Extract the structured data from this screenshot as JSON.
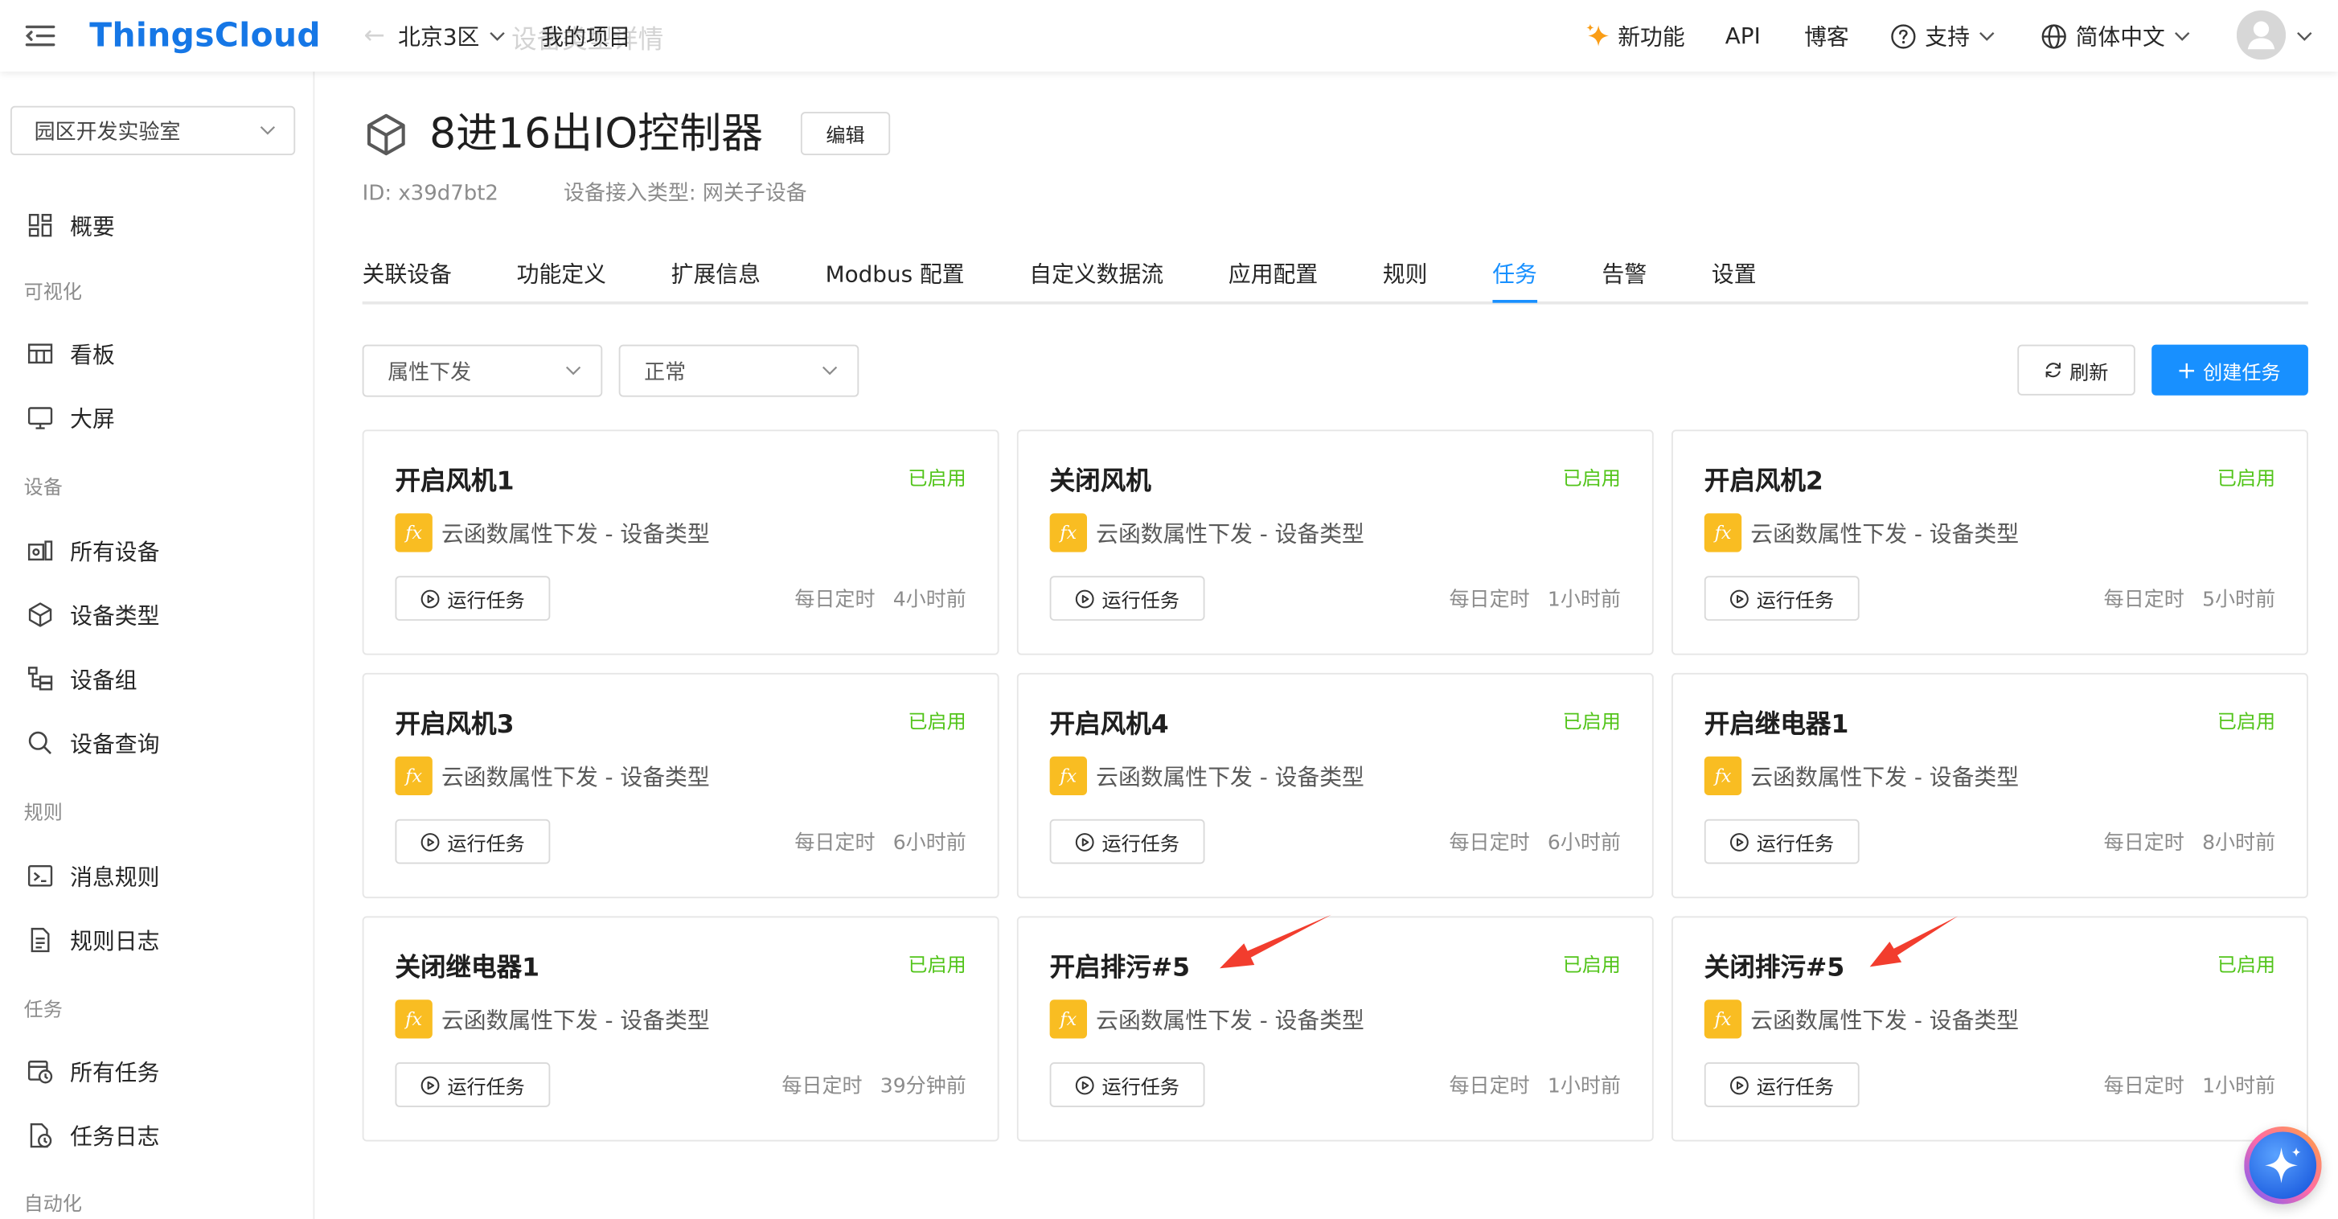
{
  "header": {
    "logo": "ThingsCloud",
    "ghost_back": "←",
    "ghost_title": "设备类型详情",
    "region": "北京3区",
    "project": "我的项目",
    "new_features": "新功能",
    "api": "API",
    "blog": "博客",
    "support": "支持",
    "language": "简体中文",
    "icons": {
      "menu": "menu-fold-icon",
      "new_features": "sparkle-icon",
      "support": "help-circle-icon",
      "language": "globe-icon",
      "avatar": "user-avatar-icon"
    }
  },
  "sidebar": {
    "workspace": "园区开发实验室",
    "overview": {
      "label": "概要",
      "icon": "grid-icon"
    },
    "sections": [
      {
        "label": "可视化",
        "items": [
          {
            "label": "看板",
            "icon": "dashboard-icon"
          },
          {
            "label": "大屏",
            "icon": "monitor-icon"
          }
        ]
      },
      {
        "label": "设备",
        "items": [
          {
            "label": "所有设备",
            "icon": "devices-icon"
          },
          {
            "label": "设备类型",
            "icon": "cube-icon"
          },
          {
            "label": "设备组",
            "icon": "device-group-icon"
          },
          {
            "label": "设备查询",
            "icon": "search-icon"
          }
        ]
      },
      {
        "label": "规则",
        "items": [
          {
            "label": "消息规则",
            "icon": "terminal-icon"
          },
          {
            "label": "规则日志",
            "icon": "file-text-icon"
          }
        ]
      },
      {
        "label": "任务",
        "items": [
          {
            "label": "所有任务",
            "icon": "task-list-icon"
          },
          {
            "label": "任务日志",
            "icon": "task-log-icon"
          }
        ]
      },
      {
        "label": "自动化",
        "items": []
      }
    ]
  },
  "device": {
    "name": "8进16出IO控制器",
    "icon": "cube-icon",
    "edit_label": "编辑",
    "id_text": "ID: x39d7bt2",
    "access_type": "设备接入类型: 网关子设备"
  },
  "tabs": [
    {
      "label": "关联设备"
    },
    {
      "label": "功能定义"
    },
    {
      "label": "扩展信息"
    },
    {
      "label": "Modbus 配置"
    },
    {
      "label": "自定义数据流"
    },
    {
      "label": "应用配置"
    },
    {
      "label": "规则"
    },
    {
      "label": "任务",
      "active": true
    },
    {
      "label": "告警"
    },
    {
      "label": "设置"
    }
  ],
  "filters": {
    "type": "属性下发",
    "status": "正常"
  },
  "actions": {
    "refresh": "刷新",
    "create": "创建任务"
  },
  "icons": {
    "function_glyph": "fx"
  },
  "tasks": [
    {
      "title": "开启风机1",
      "status": "已启用",
      "trigger": "云函数属性下发 - 设备类型",
      "run_label": "运行任务",
      "schedule": "每日定时",
      "last_run": "4小时前"
    },
    {
      "title": "关闭风机",
      "status": "已启用",
      "trigger": "云函数属性下发 - 设备类型",
      "run_label": "运行任务",
      "schedule": "每日定时",
      "last_run": "1小时前"
    },
    {
      "title": "开启风机2",
      "status": "已启用",
      "trigger": "云函数属性下发 - 设备类型",
      "run_label": "运行任务",
      "schedule": "每日定时",
      "last_run": "5小时前"
    },
    {
      "title": "开启风机3",
      "status": "已启用",
      "trigger": "云函数属性下发 - 设备类型",
      "run_label": "运行任务",
      "schedule": "每日定时",
      "last_run": "6小时前"
    },
    {
      "title": "开启风机4",
      "status": "已启用",
      "trigger": "云函数属性下发 - 设备类型",
      "run_label": "运行任务",
      "schedule": "每日定时",
      "last_run": "6小时前"
    },
    {
      "title": "开启继电器1",
      "status": "已启用",
      "trigger": "云函数属性下发 - 设备类型",
      "run_label": "运行任务",
      "schedule": "每日定时",
      "last_run": "8小时前"
    },
    {
      "title": "关闭继电器1",
      "status": "已启用",
      "trigger": "云函数属性下发 - 设备类型",
      "run_label": "运行任务",
      "schedule": "每日定时",
      "last_run": "39分钟前"
    },
    {
      "title": "开启排污#5",
      "status": "已启用",
      "trigger": "云函数属性下发 - 设备类型",
      "run_label": "运行任务",
      "schedule": "每日定时",
      "last_run": "1小时前"
    },
    {
      "title": "关闭排污#5",
      "status": "已启用",
      "trigger": "云函数属性下发 - 设备类型",
      "run_label": "运行任务",
      "schedule": "每日定时",
      "last_run": "1小时前"
    }
  ],
  "colors": {
    "primary": "#1890ff",
    "logo": "#1677e6",
    "enabled": "#52c41a",
    "function_icon": "#f9bd22",
    "annotation": "#f23d2e"
  }
}
